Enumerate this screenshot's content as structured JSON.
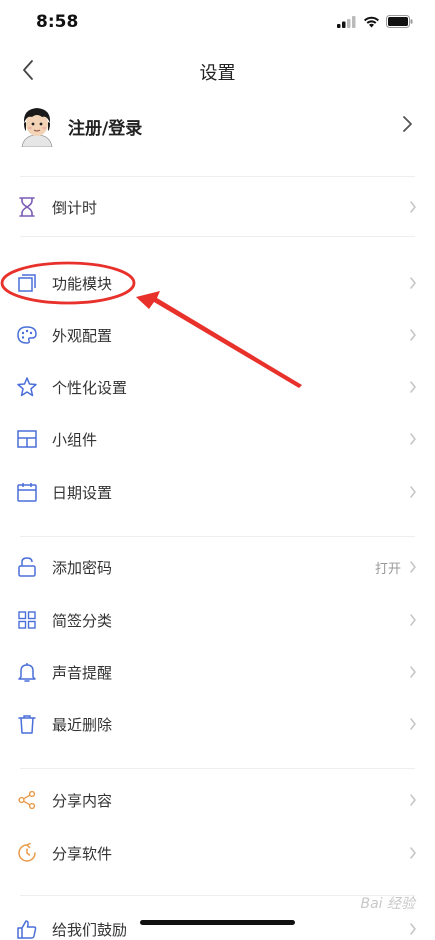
{
  "status_bar": {
    "time": "8:58"
  },
  "nav": {
    "title": "设置"
  },
  "account": {
    "label": "注册/登录"
  },
  "groups": [
    {
      "items": [
        {
          "label": "倒计时",
          "icon": "hourglass-icon"
        }
      ]
    },
    {
      "items": [
        {
          "label": "功能模块",
          "icon": "module-icon"
        },
        {
          "label": "外观配置",
          "icon": "palette-icon"
        },
        {
          "label": "个性化设置",
          "icon": "star-outline-icon"
        },
        {
          "label": "小组件",
          "icon": "widget-layout-icon"
        },
        {
          "label": "日期设置",
          "icon": "calendar-icon"
        }
      ]
    },
    {
      "items": [
        {
          "label": "添加密码",
          "icon": "lock-icon",
          "value": "打开"
        },
        {
          "label": "简签分类",
          "icon": "grid-icon"
        },
        {
          "label": "声音提醒",
          "icon": "bell-icon"
        },
        {
          "label": "最近删除",
          "icon": "trash-icon"
        }
      ]
    },
    {
      "items": [
        {
          "label": "分享内容",
          "icon": "share-icon"
        },
        {
          "label": "分享软件",
          "icon": "refresh-icon"
        }
      ]
    },
    {
      "items": [
        {
          "label": "给我们鼓励",
          "icon": "thumbs-up-icon"
        }
      ]
    }
  ],
  "colors": {
    "icon_blue": "#4a6fd8",
    "icon_purple": "#7b5bb5",
    "icon_orange": "#e89a4a",
    "annotation_red": "#e8312b"
  },
  "watermark": "Bai 经验"
}
